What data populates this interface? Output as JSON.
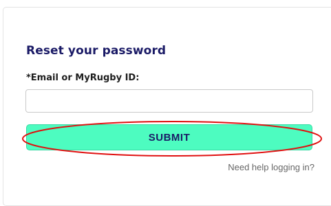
{
  "form": {
    "title": "Reset your password",
    "email_label": "*Email or MyRugby ID:",
    "email_value": "",
    "submit_label": "SUBMIT",
    "help_link": "Need help logging in?"
  },
  "colors": {
    "title": "#1a1a66",
    "button_bg": "#4dfcc0",
    "button_text": "#1a1a66",
    "highlight": "#e01010",
    "help_text": "#666666"
  }
}
